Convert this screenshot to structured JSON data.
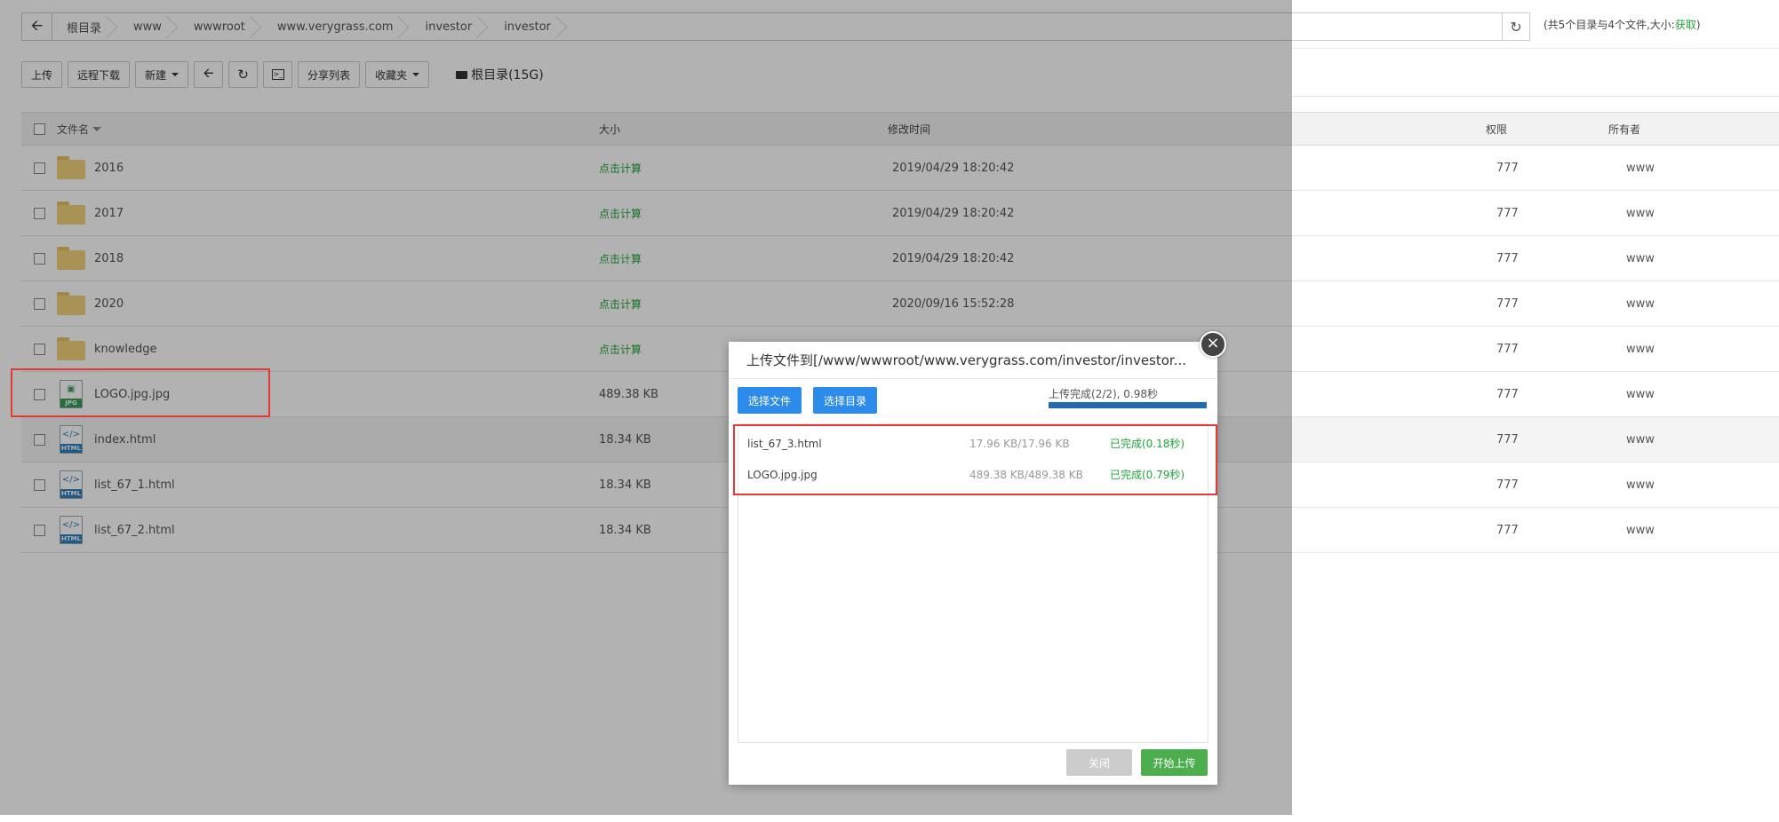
{
  "path": {
    "back_icon": "arrow-left-icon",
    "crumbs": [
      "根目录",
      "www",
      "wwwroot",
      "www.verygrass.com",
      "investor",
      "investor"
    ],
    "refresh_icon": "refresh-icon"
  },
  "summary": {
    "text": "(共5个目录与4个文件,大小:",
    "get_link": "获取",
    "close_paren": ")"
  },
  "toolbar": {
    "upload": "上传",
    "remote_download": "远程下载",
    "new": "新建",
    "share_list": "分享列表",
    "favorites": "收藏夹",
    "disk_label": "根目录(15G)"
  },
  "table": {
    "headers": {
      "name": "文件名",
      "size": "大小",
      "time": "修改时间",
      "perm": "权限",
      "owner": "所有者"
    },
    "rows": [
      {
        "type": "folder",
        "name": "2016",
        "size": "点击计算",
        "time": "2019/04/29 18:20:42",
        "perm": "777",
        "owner": "www"
      },
      {
        "type": "folder",
        "name": "2017",
        "size": "点击计算",
        "time": "2019/04/29 18:20:42",
        "perm": "777",
        "owner": "www"
      },
      {
        "type": "folder",
        "name": "2018",
        "size": "点击计算",
        "time": "2019/04/29 18:20:42",
        "perm": "777",
        "owner": "www"
      },
      {
        "type": "folder",
        "name": "2020",
        "size": "点击计算",
        "time": "2020/09/16 15:52:28",
        "perm": "777",
        "owner": "www"
      },
      {
        "type": "folder",
        "name": "knowledge",
        "size": "点击计算",
        "time": "",
        "perm": "777",
        "owner": "www"
      },
      {
        "type": "jpg",
        "name": "LOGO.jpg.jpg",
        "size": "489.38 KB",
        "time": "",
        "perm": "777",
        "owner": "www"
      },
      {
        "type": "html",
        "name": "index.html",
        "size": "18.34 KB",
        "time": "",
        "perm": "777",
        "owner": "www"
      },
      {
        "type": "html",
        "name": "list_67_1.html",
        "size": "18.34 KB",
        "time": "",
        "perm": "777",
        "owner": "www"
      },
      {
        "type": "html",
        "name": "list_67_2.html",
        "size": "18.34 KB",
        "time": "",
        "perm": "777",
        "owner": "www"
      }
    ],
    "file_icon_labels": {
      "jpg": "JPG",
      "html": "HTML"
    }
  },
  "modal": {
    "title": "上传文件到[/www/wwwroot/www.verygrass.com/investor/investor...",
    "pick_file": "选择文件",
    "pick_dir": "选择目录",
    "progress_text": "上传完成(2/2), 0.98秒",
    "progress": 1.0,
    "items": [
      {
        "name": "list_67_3.html",
        "size": "17.96 KB/17.96 KB",
        "status": "已完成(0.18秒)"
      },
      {
        "name": "LOGO.jpg.jpg",
        "size": "489.38 KB/489.38 KB",
        "status": "已完成(0.79秒)"
      }
    ],
    "close": "关闭",
    "start": "开始上传",
    "close_icon": "close-icon"
  },
  "colors": {
    "accent": "#2d8ceb",
    "success": "#20a53a",
    "highlight": "#e53935"
  }
}
